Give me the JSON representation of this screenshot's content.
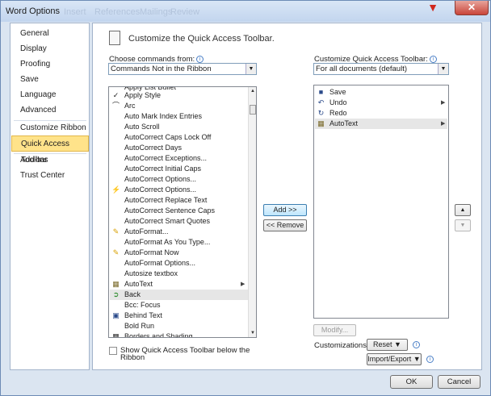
{
  "window": {
    "title": "Word Options",
    "ghost_tabs": [
      "Insert",
      "Page Layout",
      "References",
      "Mailings",
      "Review",
      "View"
    ]
  },
  "nav": {
    "items": [
      {
        "label": "General"
      },
      {
        "label": "Display"
      },
      {
        "label": "Proofing"
      },
      {
        "label": "Save"
      },
      {
        "label": "Language"
      },
      {
        "label": "Advanced"
      },
      {
        "label": "Customize Ribbon"
      },
      {
        "label": "Quick Access Toolbar",
        "selected": true
      },
      {
        "label": "Add-Ins"
      },
      {
        "label": "Trust Center"
      }
    ]
  },
  "header": {
    "title": "Customize the Quick Access Toolbar."
  },
  "left_panel": {
    "label": "Choose commands from:",
    "combo_value": "Commands Not in the Ribbon",
    "commands": [
      {
        "label": "Apply List Bullet",
        "icon": "bullet-icon"
      },
      {
        "label": "Apply Style",
        "icon": "style-pen-icon"
      },
      {
        "label": "Arc",
        "icon": "arc-icon"
      },
      {
        "label": "Auto Mark Index Entries",
        "icon": ""
      },
      {
        "label": "Auto Scroll",
        "icon": ""
      },
      {
        "label": "AutoCorrect Caps Lock Off",
        "icon": ""
      },
      {
        "label": "AutoCorrect Days",
        "icon": ""
      },
      {
        "label": "AutoCorrect Exceptions...",
        "icon": ""
      },
      {
        "label": "AutoCorrect Initial Caps",
        "icon": ""
      },
      {
        "label": "AutoCorrect Options...",
        "icon": ""
      },
      {
        "label": "AutoCorrect Options...",
        "icon": "lightning-icon"
      },
      {
        "label": "AutoCorrect Replace Text",
        "icon": ""
      },
      {
        "label": "AutoCorrect Sentence Caps",
        "icon": ""
      },
      {
        "label": "AutoCorrect Smart Quotes",
        "icon": ""
      },
      {
        "label": "AutoFormat...",
        "icon": "autoformat-icon"
      },
      {
        "label": "AutoFormat As You Type...",
        "icon": ""
      },
      {
        "label": "AutoFormat Now",
        "icon": "autoformat-icon"
      },
      {
        "label": "AutoFormat Options...",
        "icon": ""
      },
      {
        "label": "Autosize textbox",
        "icon": ""
      },
      {
        "label": "AutoText",
        "icon": "autotext-icon",
        "submenu": true
      },
      {
        "label": "Back",
        "icon": "back-arrow-icon",
        "selected": true
      },
      {
        "label": "Bcc: Focus",
        "icon": ""
      },
      {
        "label": "Behind Text",
        "icon": "behind-text-icon"
      },
      {
        "label": "Bold Run",
        "icon": ""
      },
      {
        "label": "Borders and Shading...",
        "icon": "borders-icon"
      }
    ]
  },
  "middle": {
    "add_label": "Add >>",
    "remove_label": "<< Remove"
  },
  "right_panel": {
    "label": "Customize Quick Access Toolbar:",
    "combo_value": "For all documents (default)",
    "commands": [
      {
        "label": "Save",
        "icon": "save-icon"
      },
      {
        "label": "Undo",
        "icon": "undo-icon",
        "submenu": true
      },
      {
        "label": "Redo",
        "icon": "redo-icon"
      },
      {
        "label": "AutoText",
        "icon": "autotext-icon",
        "submenu": true,
        "selected": true
      }
    ],
    "modify_label": "Modify...",
    "customizations_label": "Customizations:",
    "reset_label": "Reset ▼",
    "import_export_label": "Import/Export ▼"
  },
  "show_below": {
    "line1": "Show Quick Access Toolbar below the",
    "line2": "Ribbon",
    "checked": false
  },
  "footer": {
    "ok_label": "OK",
    "cancel_label": "Cancel"
  },
  "colors": {
    "selected_nav": "#ffe38a",
    "window_bg": "#dbe5f1",
    "list_selected": "#e6e6e6"
  }
}
